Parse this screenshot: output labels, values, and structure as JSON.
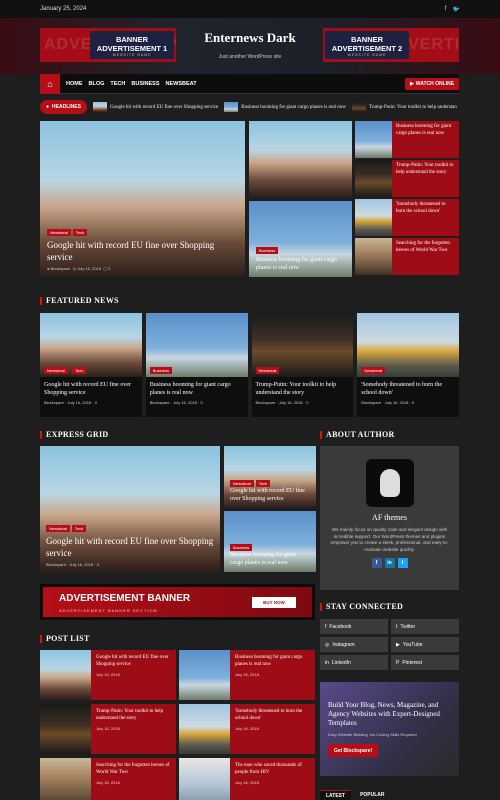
{
  "topbar": {
    "date": "January 25, 2024",
    "social_icons": [
      "facebook-icon",
      "twitter-icon"
    ]
  },
  "header": {
    "ad1": {
      "ghost": "ADVERTISEMENT",
      "line1": "BANNER",
      "line2": "ADVERTISEMENT 1",
      "sub": "WEBSITE NAME"
    },
    "site_title": "Enternews Dark",
    "tagline": "Just another WordPress site",
    "ad2": {
      "ghost": "ADVERTISEMENT",
      "line1": "BANNER",
      "line2": "ADVERTISEMENT 2",
      "sub": "WEBSITE NAME"
    }
  },
  "nav": {
    "home_icon": "home-icon",
    "items": [
      "HOME",
      "BLOG",
      "TECH",
      "BUSINESS",
      "NEWSBEAT"
    ],
    "watch_label": "WATCH ONLINE"
  },
  "ticker": {
    "label": "HEADLINES",
    "items": [
      "Google hit with record EU fine over Shopping service",
      "Business booming for giant cargo planes is real now",
      "Trump-Putin: Your toolkit to help understan"
    ]
  },
  "hero": {
    "tags": [
      "Newsbeat",
      "Tech"
    ],
    "title": "Google hit with record EU fine over Shopping service",
    "author": "Blockspare",
    "date": "July 16, 2018",
    "comments": "0"
  },
  "mid": [
    {
      "tags": [],
      "title": ""
    },
    {
      "tags": [
        "Business"
      ],
      "title": "Business booming for giant cargo planes is real now"
    }
  ],
  "side_list": [
    "Business booming for giant cargo planes is real now",
    "Trump-Putin: Your toolkit to help understand the story",
    "'Somebody threatened to burn the school down'",
    "Searching for the forgotten heroes of World War Two"
  ],
  "featured": {
    "heading": "FEATURED NEWS",
    "cards": [
      {
        "tags": [
          "Newsbeat",
          "Tech"
        ],
        "title": "Google hit with record EU fine over Shopping service",
        "author": "Blockspare",
        "date": "July 16, 2018",
        "comments": "0"
      },
      {
        "tags": [
          "Business"
        ],
        "title": "Business booming for giant cargo planes is real now",
        "author": "Blockspare",
        "date": "July 16, 2018",
        "comments": "0"
      },
      {
        "tags": [
          "Newsbeat"
        ],
        "title": "Trump-Putin: Your toolkit to help understand the story",
        "author": "Blockspare",
        "date": "July 16, 2018",
        "comments": "0"
      },
      {
        "tags": [
          "Newsbeat"
        ],
        "title": "'Somebody threatened to burn the school down'",
        "author": "Blockspare",
        "date": "July 16, 2018",
        "comments": "0"
      }
    ]
  },
  "express": {
    "heading": "EXPRESS GRID",
    "big": {
      "tags": [
        "Newsbeat",
        "Tech"
      ],
      "title": "Google hit with record EU fine over Shopping service",
      "author": "Blockspare",
      "date": "July 16, 2018",
      "comments": "0"
    },
    "small": [
      {
        "tags": [
          "Newsbeat",
          "Tech"
        ],
        "title": "Google hit with record EU fine over Shopping service"
      },
      {
        "tags": [
          "Business"
        ],
        "title": "Business booming for giant cargo planes is real now"
      }
    ]
  },
  "about": {
    "heading": "ABOUT AUTHOR",
    "name": "AF themes",
    "bio": "We mainly focus on quality code and elegant design with incredible support. Our WordPress themes and plugins empower you to create a sleek, professional, and easy-to-maintain website quickly.",
    "social": [
      {
        "icon": "facebook-icon",
        "glyph": "f",
        "color": "#3b5998"
      },
      {
        "icon": "linkedin-icon",
        "glyph": "in",
        "color": "#0e76a8"
      },
      {
        "icon": "twitter-icon",
        "glyph": "t",
        "color": "#1da1f2"
      }
    ]
  },
  "ad_banner": {
    "title": "ADVERTISEMENT BANNER",
    "sub": "ADVERTISEMENT BANNER SECTION",
    "button": "BUY NOW"
  },
  "stay": {
    "heading": "STAY CONNECTED",
    "buttons": [
      {
        "icon": "facebook-icon",
        "glyph": "f",
        "label": "Facebook"
      },
      {
        "icon": "twitter-icon",
        "glyph": "t",
        "label": "Twitter"
      },
      {
        "icon": "instagram-icon",
        "glyph": "◎",
        "label": "Instagram"
      },
      {
        "icon": "youtube-icon",
        "glyph": "▶",
        "label": "YouTube"
      },
      {
        "icon": "linkedin-icon",
        "glyph": "in",
        "label": "LinkedIn"
      },
      {
        "icon": "pinterest-icon",
        "glyph": "P",
        "label": "Pinterest"
      }
    ]
  },
  "post_list": {
    "heading": "POST LIST",
    "posts": [
      {
        "img": "city",
        "title": "Google hit with record EU fine over Shopping service",
        "date": "July 16, 2018"
      },
      {
        "img": "plane",
        "title": "Business booming for giant cargo planes is real now",
        "date": "July 16, 2018"
      },
      {
        "img": "people",
        "title": "Trump-Putin: Your toolkit to help understand the story",
        "date": "July 16, 2018"
      },
      {
        "img": "bus",
        "title": "'Somebody threatened to burn the school down'",
        "date": "July 16, 2018"
      },
      {
        "img": "medals",
        "title": "Searching for the forgotten heroes of World War Two",
        "date": "July 16, 2018"
      },
      {
        "img": "hiv",
        "title": "The man who saved thousands of people from HIV",
        "date": "July 16, 2018"
      }
    ]
  },
  "bs_ad": {
    "title": "Build Your Blog, News, Magazine, and Agency Websites with Expert-Designed Templates",
    "sub": "Easy Website Building, No Coding Skills Required",
    "button": "Get Blockspare!"
  },
  "tabs": [
    "LATEST",
    "POPULAR"
  ],
  "colors": {
    "accent": "#b50e17",
    "background": "#1e1e1e"
  }
}
